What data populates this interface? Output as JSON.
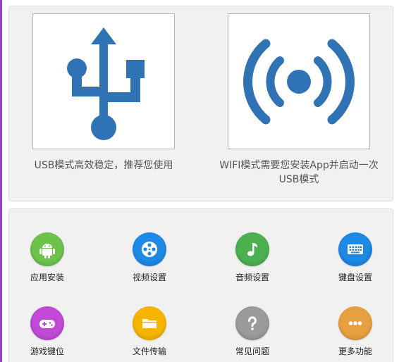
{
  "modes": {
    "usb": {
      "caption": "USB模式高效稳定，推荐您使用",
      "icon": "usb-icon",
      "color": "#2f73b4"
    },
    "wifi": {
      "caption": "WIFI模式需要您安装App并启动一次USB模式",
      "icon": "wifi-signal-icon",
      "color": "#2f73b4"
    }
  },
  "tools": [
    {
      "label": "应用安装",
      "icon": "android-icon",
      "color": "#6cc24a"
    },
    {
      "label": "视频设置",
      "icon": "film-reel-icon",
      "color": "#1e88e5"
    },
    {
      "label": "音频设置",
      "icon": "music-note-icon",
      "color": "#4caf50"
    },
    {
      "label": "键盘设置",
      "icon": "keyboard-icon",
      "color": "#1e88e5"
    },
    {
      "label": "游戏键位",
      "icon": "gamepad-icon",
      "color": "#c04ad6"
    },
    {
      "label": "文件传输",
      "icon": "folder-icon",
      "color": "#f5b400"
    },
    {
      "label": "常见问题",
      "icon": "question-icon",
      "color": "#9a9a9a"
    },
    {
      "label": "更多功能",
      "icon": "more-icon",
      "color": "#e6a040"
    }
  ]
}
